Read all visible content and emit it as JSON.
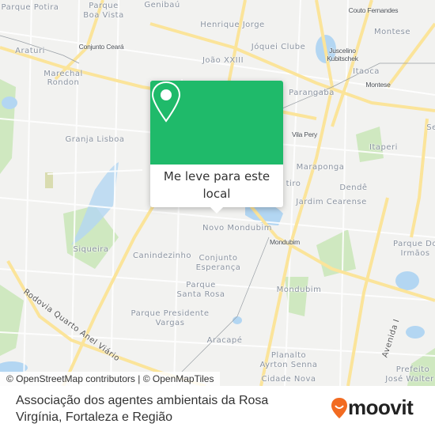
{
  "map": {
    "labels": [
      "Parque Potira",
      "Parque",
      "Boa Vista",
      "Genibaú",
      "Henrique Jorge",
      "Couto Fernandes",
      "Montese",
      "Araturi",
      "Conjunto Ceará",
      "Jóquei Clube",
      "Juscelino",
      "Kubitschek",
      "João XXIII",
      "Marechal",
      "Rondon",
      "Itaoca",
      "Montese",
      "Parangaba",
      "Vila Pery",
      "Granja Lisboa",
      "Itaperi",
      "Se",
      "Maraponga",
      "Dendê",
      "Jardim Cearense",
      "Novo Mondubim",
      "Mondubim",
      "Parque Do",
      "Irmãos",
      "Siqueira",
      "Canindezinho",
      "Conjunto",
      "Esperança",
      "Parque",
      "Santa Rosa",
      "Mondubim",
      "Parque Presidente",
      "Vargas",
      "Aracapé",
      "Planalto",
      "Ayrton Senna",
      "Cidade Nova",
      "Avenida I",
      "Rodovia Quarto Anel Viário",
      "Prefeito",
      "José Walter",
      "tiro"
    ],
    "colors": {
      "land": "#f2f2f0",
      "road_major": "#fbe49a",
      "water": "#b3d6f2",
      "park": "#cfe8c0",
      "popup_green": "#1fba6a"
    }
  },
  "popup": {
    "icon": "map-pin-icon",
    "line1": "Me leve para este",
    "line2": "local"
  },
  "attribution": "© OpenStreetMap contributors | © OpenMapTiles",
  "footer": {
    "title": "Associação dos agentes ambientais da Rosa Virgínia, Fortaleza e Região",
    "logo": "moovit",
    "logo_color": "#f26b21"
  }
}
